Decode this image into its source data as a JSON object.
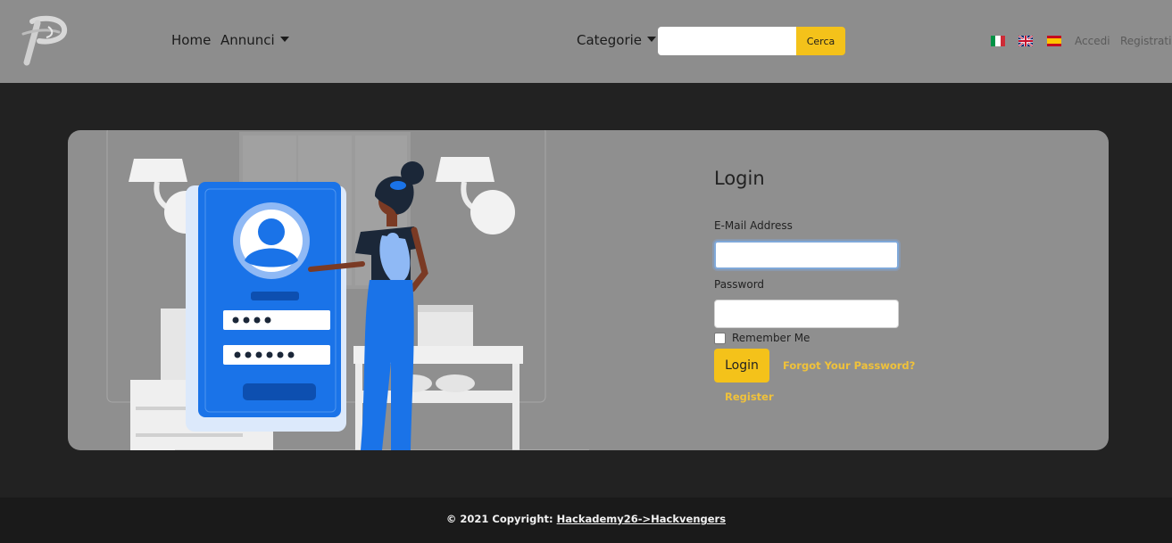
{
  "navbar": {
    "home_label": "Home",
    "annunci_label": "Annunci",
    "categorie_label": "Categorie",
    "search_placeholder": "",
    "search_value": "",
    "search_button": "Cerca",
    "flags": [
      "flag-it-icon",
      "flag-uk-icon",
      "flag-es-icon"
    ],
    "accedi_label": "Accedi",
    "registrati_label": "Registrati"
  },
  "login": {
    "title": "Login",
    "email_label": "E-Mail Address",
    "email_value": "",
    "password_label": "Password",
    "password_value": "",
    "remember_label": "Remember Me",
    "login_button": "Login",
    "forgot_link": "Forgot Your Password?",
    "register_link": "Register"
  },
  "footer": {
    "copyright_prefix": "© 2021 Copyright: ",
    "copyright_link": "Hackademy26->Hackvengers"
  },
  "colors": {
    "accent": "#f4c21a",
    "navbar_bg": "#8d8d8d",
    "page_bg": "#222222",
    "card_bg": "#8f8f8f",
    "phone_blue": "#1a73e8"
  }
}
